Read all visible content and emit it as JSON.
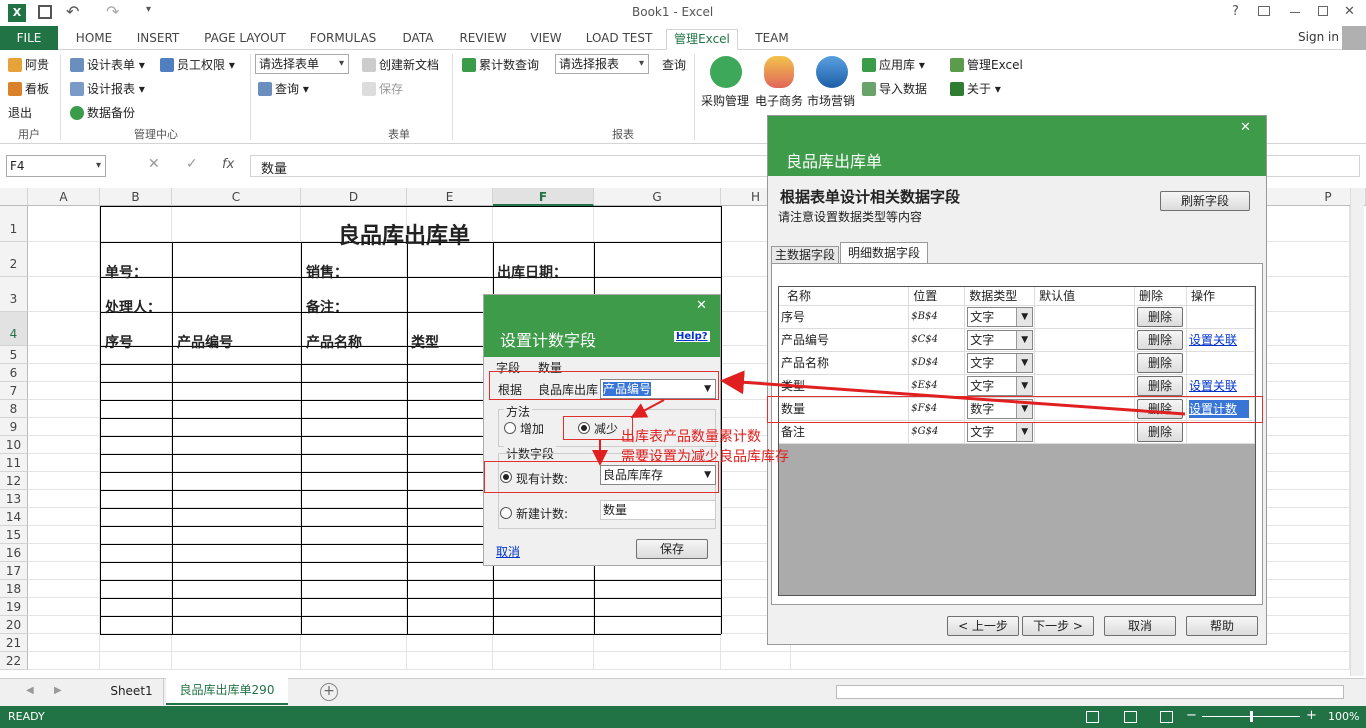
{
  "window": {
    "title": "Book1 - Excel",
    "signin": "Sign in",
    "help": "?",
    "close": "✕"
  },
  "tabs": [
    "FILE",
    "HOME",
    "INSERT",
    "PAGE LAYOUT",
    "FORMULAS",
    "DATA",
    "REVIEW",
    "VIEW",
    "LOAD TEST",
    "管理Excel",
    "TEAM"
  ],
  "ribbon": {
    "user": {
      "items": [
        "阿贵",
        "看板",
        "退出"
      ],
      "label": "用户"
    },
    "mgmt": {
      "items": [
        "设计表单",
        "员工权限",
        "设计报表",
        "数据备份"
      ],
      "label": "管理中心"
    },
    "form": {
      "select": "请选择表单",
      "query": "查询",
      "create": "创建新文档",
      "save": "保存",
      "label": "表单"
    },
    "report": {
      "cum": "累计数查询",
      "select": "请选择报表",
      "query": "查询",
      "label": "报表"
    },
    "apps": [
      "采购管理",
      "电子商务",
      "市场营销"
    ],
    "lib": {
      "lib": "应用库",
      "import": "导入数据",
      "mgr": "管理Excel",
      "about": "关于"
    }
  },
  "formula": {
    "namebox": "F4",
    "fx": "fx",
    "value": "数量"
  },
  "columns": [
    "A",
    "B",
    "C",
    "D",
    "E",
    "F",
    "G",
    "H",
    "P"
  ],
  "rows": [
    "1",
    "2",
    "3",
    "4",
    "5",
    "6",
    "7",
    "8",
    "9",
    "10",
    "11",
    "12",
    "13",
    "14",
    "15",
    "16",
    "17",
    "18",
    "19",
    "20",
    "21",
    "22"
  ],
  "sheet": {
    "title": "良品库出库单",
    "r2": [
      "单号：",
      "销售：",
      "出库日期："
    ],
    "r3": [
      "处理人：",
      "备注："
    ],
    "r4": [
      "序号",
      "产品编号",
      "产品名称",
      "类型"
    ]
  },
  "sheettabs": [
    "Sheet1",
    "良品库出库单290"
  ],
  "status": {
    "ready": "READY",
    "zoom": "100%"
  },
  "panel": {
    "header": "良品库出库单",
    "heading": "根据表单设计相关数据字段",
    "sub": "请注意设置数据类型等内容",
    "refresh": "刷新字段",
    "tabs": [
      "主数据字段",
      "明细数据字段"
    ],
    "cols": [
      "名称",
      "位置",
      "数据类型",
      "默认值",
      "删除",
      "操作"
    ],
    "rows": [
      {
        "name": "序号",
        "pos": "$B$4",
        "type": "文字",
        "del": "删除",
        "op": ""
      },
      {
        "name": "产品编号",
        "pos": "$C$4",
        "type": "文字",
        "del": "删除",
        "op": "设置关联"
      },
      {
        "name": "产品名称",
        "pos": "$D$4",
        "type": "文字",
        "del": "删除",
        "op": ""
      },
      {
        "name": "类型",
        "pos": "$E$4",
        "type": "文字",
        "del": "删除",
        "op": "设置关联"
      },
      {
        "name": "数量",
        "pos": "$F$4",
        "type": "数字",
        "del": "删除",
        "op": "设置计数"
      },
      {
        "name": "备注",
        "pos": "$G$4",
        "type": "文字",
        "del": "删除",
        "op": ""
      }
    ],
    "buttons": [
      "< 上一步",
      "下一步 >",
      "取消",
      "帮助"
    ]
  },
  "dialog": {
    "title": "设置计数字段",
    "help": "Help?",
    "field_label": "字段",
    "field_value": "数量",
    "basis_label": "根据",
    "basis_text": "良品库出库",
    "basis_select": "产品编号",
    "method_label": "方法",
    "add": "增加",
    "reduce": "减少",
    "count_label": "计数字段",
    "existing": "现有计数:",
    "existing_value": "良品库库存",
    "newcount": "新建计数:",
    "new_value": "数量",
    "cancel": "取消",
    "save": "保存"
  },
  "annotation": [
    "出库表产品数量累计数",
    "需要设置为减少良品库库存"
  ],
  "colors": {
    "excel_green": "#217346",
    "dialog_green": "#3e9b49",
    "annotation_red": "#e02020"
  }
}
